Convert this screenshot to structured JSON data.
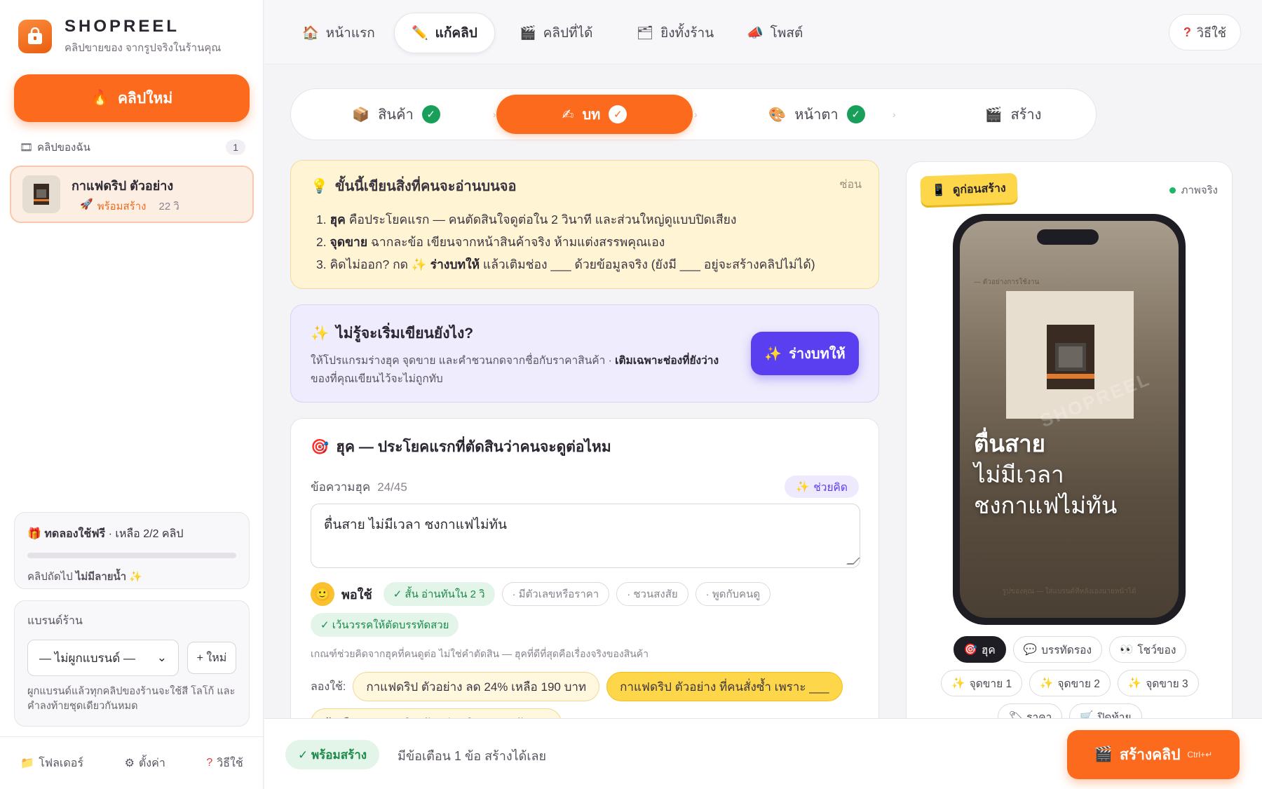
{
  "app": {
    "name": "SHOPREEL",
    "tagline": "คลิปขายของ จากรูปจริงในร้านคุณ"
  },
  "sidebar": {
    "new_clip_label": "คลิปใหม่",
    "my_clips_label": "คลิปของฉัน",
    "my_clips_count": "1",
    "clip": {
      "title": "กาแฟดริป ตัวอย่าง",
      "status": "พร้อมสร้าง",
      "duration": "22 วิ"
    },
    "trial": {
      "title": "ทดลองใช้ฟรี",
      "remaining": "เหลือ 2/2 คลิป",
      "used_fraction": 0,
      "note_prefix": "คลิปถัดไป",
      "note_bold": "ไม่มีลายน้ำ"
    },
    "brand": {
      "label": "แบรนด์ร้าน",
      "selected": "— ไม่ผูกแบรนด์ —",
      "new_label": "+ ใหม่",
      "help": "ผูกแบรนด์แล้วทุกคลิปของร้านจะใช้สี โลโก้ และคำลงท้ายชุดเดียวกันหมด"
    },
    "footer": {
      "folder": "โฟลเดอร์",
      "settings": "ตั้งค่า",
      "help": "วิธีใช้"
    }
  },
  "nav": {
    "tabs": [
      {
        "label": "หน้าแรก",
        "icon": "home-icon"
      },
      {
        "label": "แก้คลิป",
        "icon": "pencil-icon",
        "active": true
      },
      {
        "label": "คลิปที่ได้",
        "icon": "clapper-icon"
      },
      {
        "label": "ยิงทั้งร้าน",
        "icon": "folder-icon"
      },
      {
        "label": "โพสต์",
        "icon": "megaphone-icon"
      }
    ],
    "help_label": "วิธีใช้"
  },
  "stepper": {
    "steps": [
      {
        "label": "สินค้า",
        "done": true
      },
      {
        "label": "บท",
        "done": true,
        "active": true
      },
      {
        "label": "หน้าตา",
        "done": true
      },
      {
        "label": "สร้าง",
        "done": false
      }
    ]
  },
  "info": {
    "title": "ขั้นนี้เขียนสิ่งที่คนจะอ่านบนจอ",
    "hide_label": "ซ่อน",
    "items": [
      {
        "bold": "ฮุค",
        "text": " คือประโยคแรก — คนตัดสินใจดูต่อใน 2 วินาที และส่วนใหญ่ดูแบบปิดเสียง"
      },
      {
        "bold": "จุดขาย",
        "text": " ฉากละข้อ เขียนจากหน้าสินค้าจริง ห้ามแต่งสรรพคุณเอง"
      },
      {
        "pre": "คิดไม่ออก? กด ✨ ",
        "bold": "ร่างบทให้",
        "text": " แล้วเติมช่อง ___ ด้วยข้อมูลจริง (ยังมี ___ อยู่จะสร้างคลิปไม่ได้)"
      }
    ]
  },
  "draft": {
    "title": "ไม่รู้จะเริ่มเขียนยังไง?",
    "desc_plain": "ให้โปรแกรมร่างฮุค จุดขาย และคำชวนกดจากชื่อกับราคาสินค้า · ",
    "desc_bold": "เติมเฉพาะช่องที่ยังว่าง",
    "desc_tail": " ของที่คุณเขียนไว้จะไม่ถูกทับ",
    "button_label": "ร่างบทให้"
  },
  "hook": {
    "title": "ฮุค — ประโยคแรกที่ตัดสินว่าคนจะดูต่อไหม",
    "field_label": "ข้อความฮุค",
    "char_count": "24/45",
    "help_label": "ช่วยคิด",
    "value": "ตื่นสาย ไม่มีเวลา ชงกาแฟไม่ทัน",
    "score_label": "พอใช้",
    "checks": [
      {
        "label": "✓ สั้น อ่านทันใน 2 วิ",
        "ok": true
      },
      {
        "label": "· มีตัวเลขหรือราคา",
        "ok": false
      },
      {
        "label": "· ชวนสงสัย",
        "ok": false
      },
      {
        "label": "· พูดกับคนดู",
        "ok": false
      },
      {
        "label": "✓ เว้นวรรคให้ตัดบรรทัดสวย",
        "ok": true
      }
    ],
    "criteria_note": "เกณฑ์ช่วยคิดจากฮุคที่คนดูต่อ ไม่ใช่คำตัดสิน — ฮุคที่ดีที่สุดคือเรื่องจริงของสินค้า",
    "try_label": "ลองใช้:",
    "suggestions": [
      "กาแฟดริป ตัวอย่าง ลด 24% เหลือ 190 บาท",
      "กาแฟดริป ตัวอย่าง ที่คนสั่งซ้ำ เพราะ ___",
      "ถ้าเลือก กาแฟดริป ตัวอย่าง ผิด จะเจอปัญหา"
    ]
  },
  "preview": {
    "tag": "ดูก่อนสร้าง",
    "status": "ภาพจริง",
    "example_label": "— ตัวอย่างการใช้งาน",
    "watermark": "SHOPREEL",
    "lines": [
      "ตื่นสาย",
      "ไม่มีเวลา",
      "ชงกาแฟไม่ทัน"
    ],
    "footer": "รูปของคุณ — ใส่แบรนด์ทีหลังเองนายหน้าได้",
    "chips": [
      {
        "label": "ฮุค",
        "icon": "target-icon",
        "active": true
      },
      {
        "label": "บรรทัดรอง",
        "icon": "speech-icon"
      },
      {
        "label": "โชว์ของ",
        "icon": "eyes-icon"
      },
      {
        "label": "จุดขาย 1",
        "icon": "sparkle-icon"
      },
      {
        "label": "จุดขาย 2",
        "icon": "sparkle-icon"
      },
      {
        "label": "จุดขาย 3",
        "icon": "sparkle-icon"
      },
      {
        "label": "ราคา",
        "icon": "tag-icon"
      },
      {
        "label": "ปิดท้าย",
        "icon": "cart-icon"
      }
    ]
  },
  "bottom": {
    "ready_label": "✓ พร้อมสร้าง",
    "warning": "มีข้อเตือน 1 ข้อ สร้างได้เลย",
    "create_label": "สร้างคลิป",
    "shortcut": "Ctrl+↵"
  },
  "colors": {
    "accent": "#fb6a1d",
    "violet": "#5a3ff0",
    "success": "#18a05a",
    "note_bg": "#fff4d4"
  }
}
